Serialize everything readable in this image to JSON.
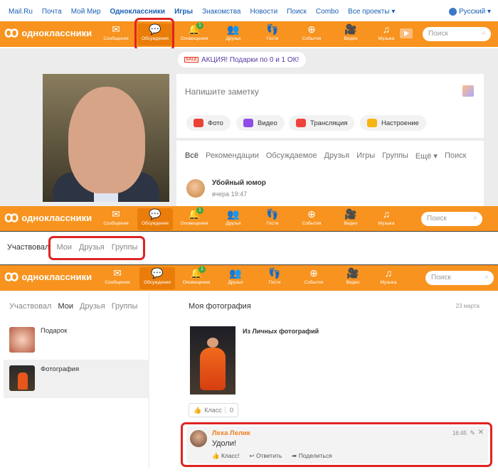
{
  "mailbar": {
    "links": [
      "Mail.Ru",
      "Почта",
      "Мой Мир",
      "Одноклассники",
      "Игры",
      "Знакомства",
      "Новости",
      "Поиск",
      "Combo",
      "Все проекты ▾"
    ],
    "lang": "Русский ▾"
  },
  "brand": "одноклассники",
  "nav": [
    {
      "icon": "envelope-icon",
      "label": "Сообщения"
    },
    {
      "icon": "chat-bubbles-icon",
      "label": "Обсуждения"
    },
    {
      "icon": "bell-icon",
      "label": "Оповещения",
      "badge": "1"
    },
    {
      "icon": "friends-icon",
      "label": "Друзья"
    },
    {
      "icon": "footprints-icon",
      "label": "Гости"
    },
    {
      "icon": "events-icon",
      "label": "События"
    },
    {
      "icon": "video-camera-icon",
      "label": "Видео"
    },
    {
      "icon": "music-note-icon",
      "label": "Музыка"
    }
  ],
  "search_placeholder": "Поиск",
  "promo": {
    "badge": "SALE",
    "text": "АКЦИЯ! Подарки по 0 и 1 ОК!"
  },
  "note": {
    "placeholder": "Напишите заметку",
    "pills": [
      {
        "label": "Фото",
        "color": "#e84335"
      },
      {
        "label": "Видео",
        "color": "#8f4ce8"
      },
      {
        "label": "Трансляция",
        "color": "#f0433c"
      },
      {
        "label": "Настроение",
        "color": "#f6b60f"
      }
    ]
  },
  "feed_tabs": [
    "Всё",
    "Рекомендации",
    "Обсуждаемое",
    "Друзья",
    "Игры",
    "Группы",
    "Ещё ▾",
    "Поиск"
  ],
  "post": {
    "title": "Убойный юмор",
    "time": "вчера 19:47"
  },
  "sub_tabs": [
    "Участвовал",
    "Мои",
    "Друзья",
    "Группы"
  ],
  "left_items": [
    {
      "title": "Подарок"
    },
    {
      "title": "Фотография"
    }
  ],
  "right": {
    "title": "Моя фотография",
    "date": "23 марта",
    "caption": "Из Личных фотографий",
    "like_label": "Класс",
    "like_count": "0"
  },
  "comment": {
    "author": "Леха Лелик",
    "time": "16:45",
    "text": "Удоли!",
    "actions": [
      "Класс!",
      "Ответить",
      "Поделиться"
    ]
  },
  "colors": {
    "accent": "#f7931e",
    "highlight": "#e02323"
  }
}
